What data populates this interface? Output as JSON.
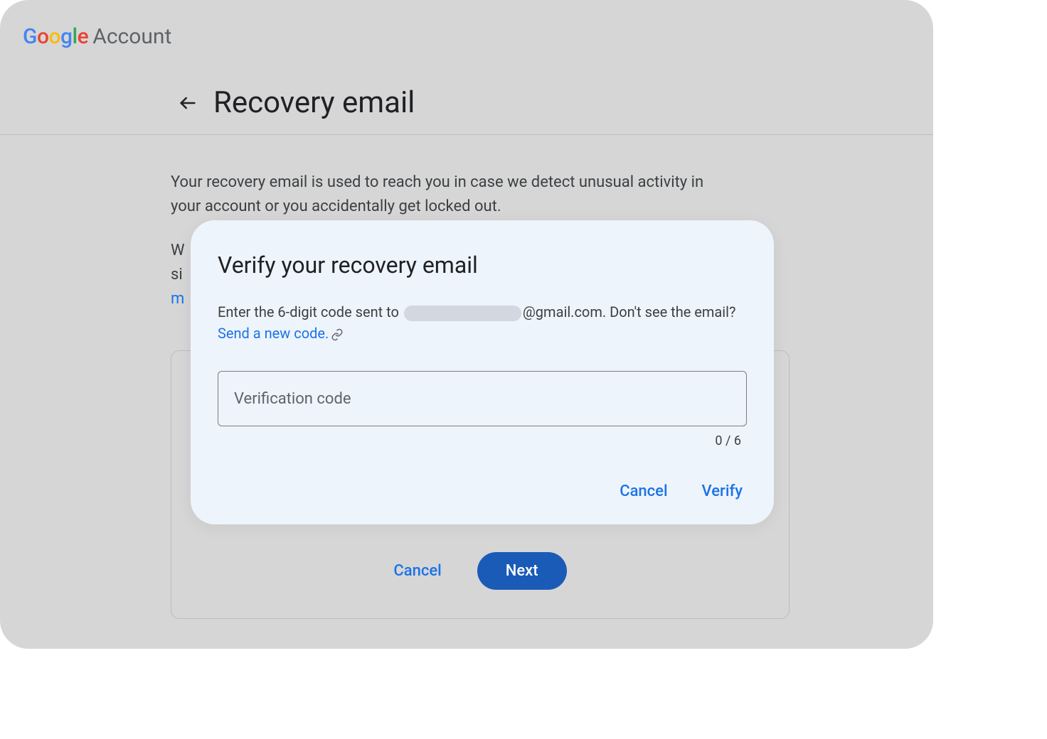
{
  "header": {
    "logo_letters": [
      "G",
      "o",
      "o",
      "g",
      "l",
      "e"
    ],
    "account_word": "Account"
  },
  "page": {
    "title": "Recovery email",
    "description": "Your recovery email is used to reach you in case we detect unusual activity in your account or you accidentally get locked out.",
    "partial_line1": "W",
    "partial_line2": "si",
    "partial_link": "m"
  },
  "background_card": {
    "cancel_label": "Cancel",
    "next_label": "Next"
  },
  "dialog": {
    "title": "Verify your recovery email",
    "body_prefix": "Enter the 6-digit code sent to ",
    "email_domain": "@gmail.com.",
    "body_suffix": " Don't see the email? ",
    "send_new_code": "Send a new code.",
    "input_placeholder": "Verification code",
    "input_value": "",
    "counter": "0 / 6",
    "cancel_label": "Cancel",
    "verify_label": "Verify"
  }
}
